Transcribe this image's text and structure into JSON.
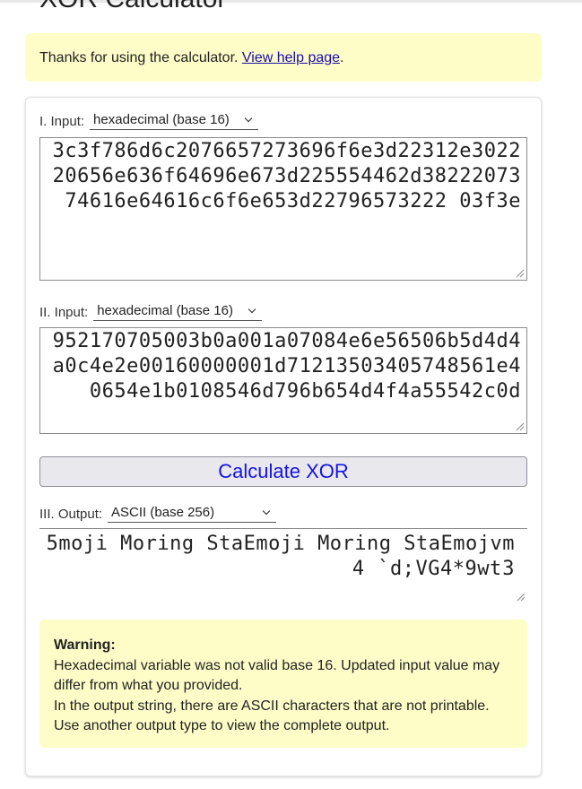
{
  "page": {
    "title": "XOR Calculator"
  },
  "thanks": {
    "text": "Thanks for using the calculator. ",
    "link": "View help page",
    "period": "."
  },
  "input1": {
    "label": "I. Input:",
    "type": "hexadecimal (base 16)",
    "value": "3c3f786d6c2076657273696f6e3d22312e302220656e636f64696e673d225554462d3822207374616e64616c6f6e653d22796573222 03f3e"
  },
  "input2": {
    "label": "II. Input:",
    "type": "hexadecimal (base 16)",
    "value": "952170705003b0a001a07084e6e56506b5d4d4a0c4e2e00160000001d71213503405748561e40654e1b0108546d796b654d4f4a55542c0d"
  },
  "calculate": {
    "label": "Calculate XOR"
  },
  "output": {
    "label": "III. Output:",
    "type": "ASCII (base 256)",
    "value": "5moji Moring StaEmoji Moring StaEmojvm4\u0004 \u001f`d;\u0003\u001cVG4*9wt\u00133"
  },
  "warning": {
    "title": "Warning:",
    "line1": "Hexadecimal variable was not valid base 16. Updated input value may differ from what you provided.",
    "line2": "In the output string, there are ASCII characters that are not printable. Use another output type to view the complete output."
  }
}
